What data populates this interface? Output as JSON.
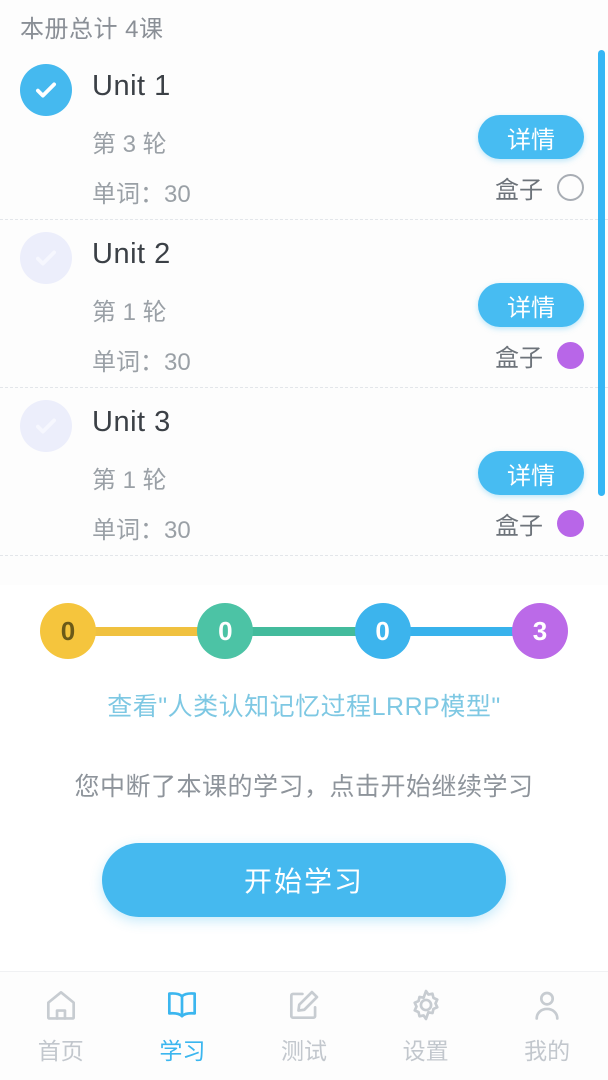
{
  "header": {
    "title": "本册总计 4课"
  },
  "colors": {
    "primary_blue": "#45b9ef",
    "detail_blue": "#47bcf2",
    "purple_dot": "#b866e8",
    "link_blue": "#7ec8e3",
    "muted_text": "#9aa0a6",
    "bubble_yellow": "#f5c53d",
    "bubble_teal": "#4cc3a5",
    "bubble_blue": "#3cb4ed",
    "bubble_purple": "#bb6ae8"
  },
  "units": [
    {
      "title": "Unit 1",
      "round": "第 3 轮",
      "words": "单词：30",
      "detail_label": "详情",
      "box_label": "盒子",
      "box_state": "empty",
      "completed": true
    },
    {
      "title": "Unit 2",
      "round": "第 1 轮",
      "words": "单词：30",
      "detail_label": "详情",
      "box_label": "盒子",
      "box_state": "purple",
      "completed": false
    },
    {
      "title": "Unit 3",
      "round": "第 1 轮",
      "words": "单词：30",
      "detail_label": "详情",
      "box_label": "盒子",
      "box_state": "purple",
      "completed": false
    }
  ],
  "progress": {
    "bubbles": [
      {
        "value": "0",
        "color": "#f5c53d",
        "text_color": "#6b5a18"
      },
      {
        "value": "0",
        "color": "#4cc3a5",
        "text_color": "#ffffff"
      },
      {
        "value": "0",
        "color": "#3cb4ed",
        "text_color": "#ffffff"
      },
      {
        "value": "3",
        "color": "#bb6ae8",
        "text_color": "#ffffff"
      }
    ],
    "connectors": [
      "#f0c13f",
      "#43bb9c",
      "#38b2ec"
    ]
  },
  "model_link": "查看\"人类认知记忆过程LRRP模型\"",
  "status_text": "您中断了本课的学习，点击开始继续学习",
  "start_button": "开始学习",
  "tabs": [
    {
      "label": "首页",
      "icon": "home-icon",
      "active": false
    },
    {
      "label": "学习",
      "icon": "book-icon",
      "active": true
    },
    {
      "label": "测试",
      "icon": "edit-icon",
      "active": false
    },
    {
      "label": "设置",
      "icon": "gear-icon",
      "active": false
    },
    {
      "label": "我的",
      "icon": "person-icon",
      "active": false
    }
  ]
}
